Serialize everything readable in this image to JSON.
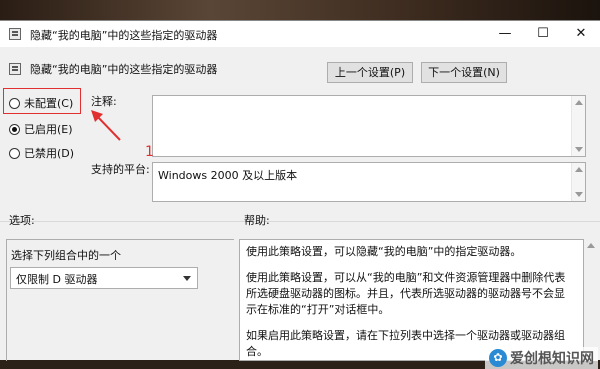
{
  "window": {
    "title": "隐藏“我的电脑”中的这些指定的驱动器",
    "minimize_glyph": "—",
    "maximize_glyph": "☐",
    "close_glyph": "✕"
  },
  "header": {
    "title": "隐藏“我的电脑”中的这些指定的驱动器",
    "prev_button": "上一个设置(P)",
    "next_button": "下一个设置(N)"
  },
  "state": {
    "options": [
      {
        "label": "未配置(C)",
        "checked": false
      },
      {
        "label": "已启用(E)",
        "checked": true
      },
      {
        "label": "已禁用(D)",
        "checked": false
      }
    ]
  },
  "comment": {
    "label": "注释:",
    "value": ""
  },
  "platform": {
    "label": "支持的平台:",
    "value": "Windows 2000 及以上版本"
  },
  "annotation": {
    "number": "1",
    "color": "#e03030"
  },
  "options_panel": {
    "label": "选项:",
    "combo_caption": "选择下列组合中的一个",
    "dropdown_value": "仅限制 D 驱动器"
  },
  "help_panel": {
    "label": "帮助:",
    "paragraphs": [
      "使用此策略设置，可以隐藏“我的电脑”中的指定驱动器。",
      "使用此策略设置，可以从“我的电脑”和文件资源管理器中删除代表所选硬盘驱动器的图标。并且，代表所选驱动器的驱动器号不会显示在标准的“打开”对话框中。",
      "如果启用此策略设置，请在下拉列表中选择一个驱动器或驱动器组合。"
    ]
  },
  "watermark": {
    "text": "爱创根知识网"
  }
}
